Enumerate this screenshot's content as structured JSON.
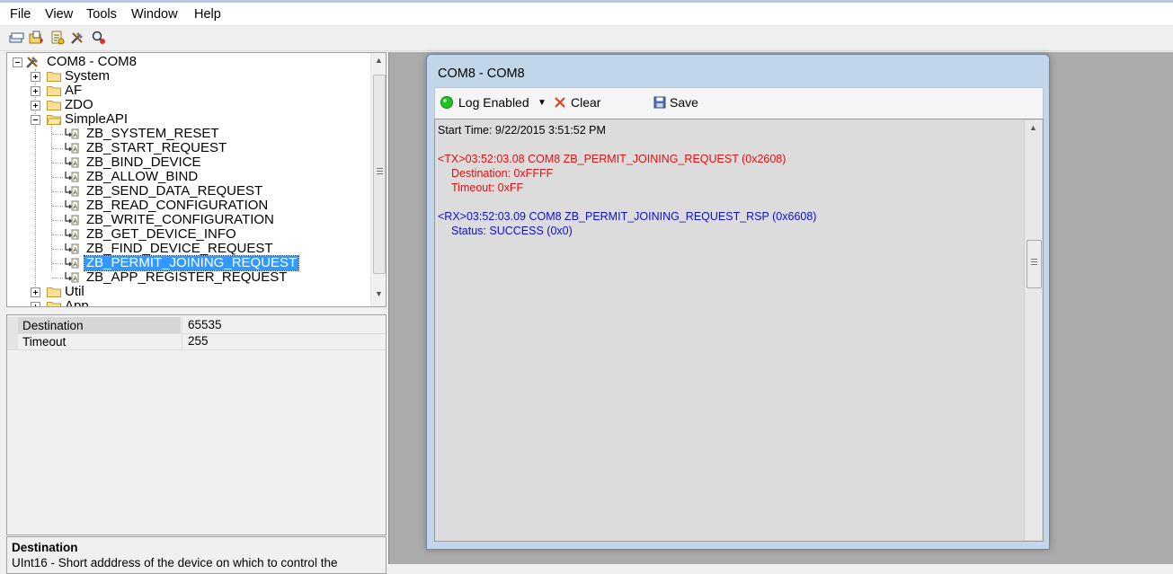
{
  "menu": [
    "File",
    "View",
    "Tools",
    "Window",
    "Help"
  ],
  "toolbar_icons": [
    "new-device-icon",
    "open-icon",
    "script-icon",
    "tools-icon",
    "find-icon"
  ],
  "tree": {
    "root": "COM8 - COM8",
    "folders": [
      "System",
      "AF",
      "ZDO",
      "SimpleAPI"
    ],
    "simpleapi_items": [
      "ZB_SYSTEM_RESET",
      "ZB_START_REQUEST",
      "ZB_BIND_DEVICE",
      "ZB_ALLOW_BIND",
      "ZB_SEND_DATA_REQUEST",
      "ZB_READ_CONFIGURATION",
      "ZB_WRITE_CONFIGURATION",
      "ZB_GET_DEVICE_INFO",
      "ZB_FIND_DEVICE_REQUEST",
      "ZB_PERMIT_JOINING_REQUEST",
      "ZB_APP_REGISTER_REQUEST"
    ],
    "selected": "ZB_PERMIT_JOINING_REQUEST",
    "after": [
      "Util",
      "App"
    ]
  },
  "properties": [
    {
      "name": "Destination",
      "value": "65535"
    },
    {
      "name": "Timeout",
      "value": "255"
    }
  ],
  "description": {
    "title": "Destination",
    "text": "UInt16 - Short adddress of the device on which to control the"
  },
  "log_window": {
    "title": "COM8 - COM8",
    "toolbar": {
      "log_enabled": "Log Enabled",
      "clear": "Clear",
      "save": "Save"
    },
    "start_time": "Start Time: 9/22/2015 3:51:52 PM",
    "tx": {
      "header": "<TX>03:52:03.08 COM8 ZB_PERMIT_JOINING_REQUEST (0x2608)",
      "lines": [
        "Destination: 0xFFFF",
        "Timeout: 0xFF"
      ]
    },
    "rx": {
      "header": "<RX>03:52:03.09 COM8 ZB_PERMIT_JOINING_REQUEST_RSP (0x6608)",
      "lines": [
        "Status: SUCCESS (0x0)"
      ]
    }
  },
  "colors": {
    "tx": "#e01010",
    "rx": "#1010cc",
    "selection": "#3399ff",
    "log_enabled_led": "#22c022"
  }
}
